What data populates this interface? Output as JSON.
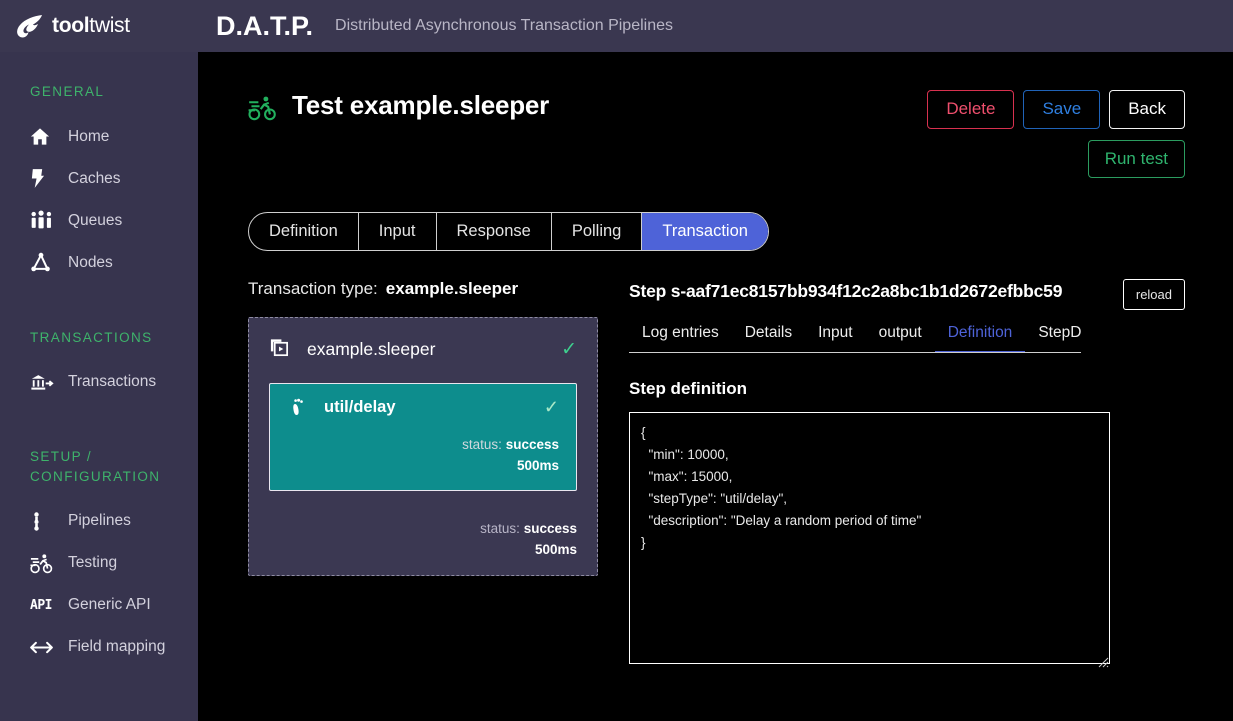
{
  "header": {
    "logo_text_bold": "tool",
    "logo_text_light": "twist",
    "logo_icon": "flame-swoosh-icon",
    "brand_abbr": "D.A.T.P.",
    "brand_subtitle": "Distributed Asynchronous Transaction Pipelines",
    "bg": "#3a3750"
  },
  "sidebar": {
    "bg": "#37344e",
    "section_color": "#3eb36b",
    "sections": [
      {
        "label": "GENERAL",
        "items": [
          {
            "label": "Home",
            "icon": "home-icon"
          },
          {
            "label": "Caches",
            "icon": "bolt-icon"
          },
          {
            "label": "Queues",
            "icon": "people-queue-icon"
          },
          {
            "label": "Nodes",
            "icon": "nodes-graph-icon"
          }
        ]
      },
      {
        "label": "TRANSACTIONS",
        "items": [
          {
            "label": "Transactions",
            "icon": "bank-transfer-icon"
          }
        ]
      },
      {
        "label": "SETUP /\nCONFIGURATION",
        "label_line1": "SETUP /",
        "label_line2": "CONFIGURATION",
        "items": [
          {
            "label": "Pipelines",
            "icon": "pipeline-icon"
          },
          {
            "label": "Testing",
            "icon": "cyclist-icon"
          },
          {
            "label": "Generic API",
            "icon": "api-icon",
            "icon_text": "API"
          },
          {
            "label": "Field mapping",
            "icon": "left-right-arrow-icon"
          }
        ]
      }
    ]
  },
  "page": {
    "title": "Test example.sleeper",
    "title_icon": "cyclist-icon",
    "buttons": [
      {
        "label": "Delete",
        "name": "delete-button",
        "color": "#ef4f6d",
        "border": "#d7314f"
      },
      {
        "label": "Save",
        "name": "save-button",
        "color": "#2f7fe0",
        "border": "#2063b8"
      },
      {
        "label": "Back",
        "name": "back-button",
        "color": "#ffffff",
        "border": "#f2f2f2"
      }
    ],
    "run_test_label": "Run test",
    "run_test_color": "#2fb46e"
  },
  "tabs": {
    "active": "Transaction",
    "active_bg": "#4e63d8",
    "items": [
      {
        "label": "Definition"
      },
      {
        "label": "Input"
      },
      {
        "label": "Response"
      },
      {
        "label": "Polling"
      },
      {
        "label": "Transaction"
      }
    ]
  },
  "transaction": {
    "type_label": "Transaction type:",
    "type_value": "example.sleeper",
    "card": {
      "title": "example.sleeper",
      "icon": "layers-copy-icon",
      "tick": "✓",
      "bg": "#3b3852",
      "status_label": "status:",
      "status_value": "success",
      "duration": "500ms"
    },
    "step": {
      "title": "util/delay",
      "icon": "footstep-icon",
      "tick": "✓",
      "bg": "#0d8d8d",
      "status_label": "status:",
      "status_value": "success",
      "duration": "500ms"
    }
  },
  "step_panel": {
    "heading_prefix": "Step",
    "step_id": "s-aaf71ec8157bb934f12c2a8bc1b1d2672efbbc59",
    "heading": "Step s-aaf71ec8157bb934f12c2a8bc1b1d2672efbbc59",
    "reload_label": "reload",
    "active_tab": "Definition",
    "active_color": "#4e63d8",
    "tabs": [
      {
        "label": "Log entries"
      },
      {
        "label": "Details"
      },
      {
        "label": "Input"
      },
      {
        "label": "output"
      },
      {
        "label": "Definition"
      },
      {
        "label": "StepD"
      }
    ],
    "definition_title": "Step definition",
    "definition_body": "{\n  \"min\": 10000,\n  \"max\": 15000,\n  \"stepType\": \"util/delay\",\n  \"description\": \"Delay a random period of time\"\n}"
  }
}
